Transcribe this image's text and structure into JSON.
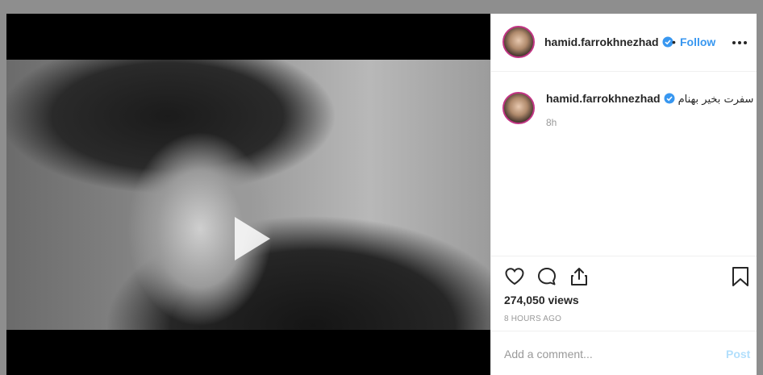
{
  "post": {
    "username": "hamid.farrokhnezhad",
    "verified": true,
    "follow_label": "Follow",
    "header_dot": "•",
    "caption": "سفرت بخیر بهنام",
    "caption_time": "8h",
    "views": "274,050 views",
    "posted_ago": "8 HOURS AGO"
  },
  "media": {
    "type": "video",
    "photo_description_icon": "play-icon"
  },
  "actions": {
    "like_icon": "heart-icon",
    "comment_icon": "comment-bubble-icon",
    "share_icon": "share-icon",
    "save_icon": "bookmark-icon"
  },
  "comment_box": {
    "placeholder": "Add a comment...",
    "value": "",
    "post_label": "Post"
  },
  "colors": {
    "accent": "#3897f0",
    "verified": "#3897f0",
    "post_disabled": "#b2dffc",
    "backdrop": "#8e8e8e"
  }
}
